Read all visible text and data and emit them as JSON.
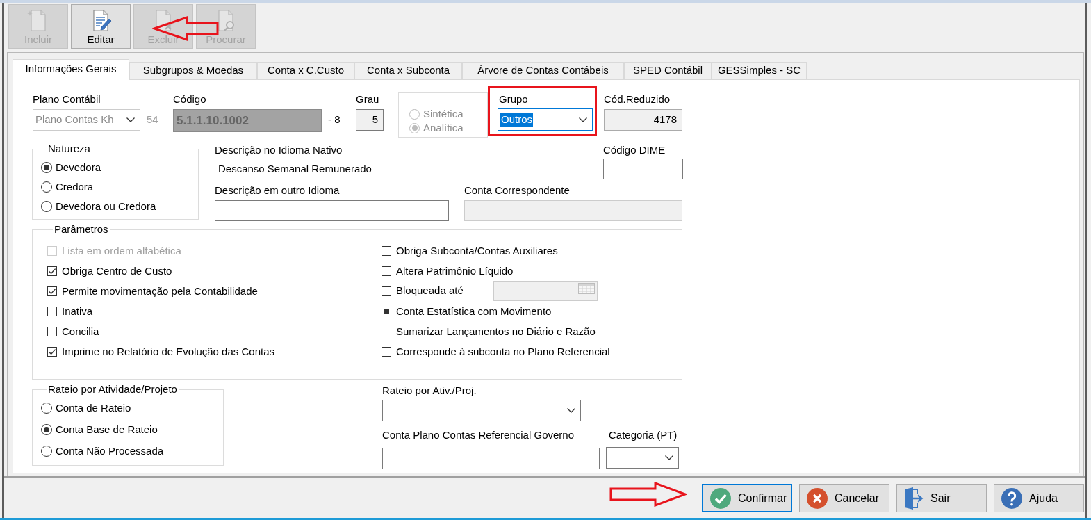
{
  "toolbar": {
    "annotation_arrow": true,
    "buttons": [
      {
        "label": "Incluir",
        "disabled": true
      },
      {
        "label": "Editar",
        "disabled": false
      },
      {
        "label": "Excluir",
        "disabled": true
      },
      {
        "label": "Procurar",
        "disabled": true
      }
    ]
  },
  "tabs": [
    {
      "label": "Informações Gerais",
      "selected": true
    },
    {
      "label": "Subgrupos & Moedas",
      "selected": false
    },
    {
      "label": "Conta x C.Custo",
      "selected": false
    },
    {
      "label": "Conta x Subconta",
      "selected": false
    },
    {
      "label": "Árvore de Contas Contábeis",
      "selected": false
    },
    {
      "label": "SPED Contábil",
      "selected": false
    },
    {
      "label": "GESSimples - SC",
      "selected": false
    }
  ],
  "general": {
    "plano_contabil": {
      "label": "Plano Contábil",
      "value": "Plano Contas Kh",
      "disabled": true,
      "number": "54"
    },
    "codigo": {
      "label": "Código",
      "value": "5.1.1.10.1002",
      "disabled": true,
      "suffix": "- 8"
    },
    "grau": {
      "label": "Grau",
      "value": "5",
      "disabled": true
    },
    "tipo": {
      "disabled": true,
      "options": [
        {
          "label": "Sintética",
          "selected": false
        },
        {
          "label": "Analítica",
          "selected": true
        }
      ]
    },
    "grupo": {
      "label": "Grupo",
      "value": "Outros",
      "focused": true,
      "annotation_box": true
    },
    "cod_reduzido": {
      "label": "Cód.Reduzido",
      "value": "4178",
      "disabled": true
    },
    "natureza": {
      "title": "Natureza",
      "options": [
        {
          "label": "Devedora",
          "selected": true
        },
        {
          "label": "Credora",
          "selected": false
        },
        {
          "label": "Devedora ou Credora",
          "selected": false
        }
      ]
    },
    "descricao_nativo": {
      "label": "Descrição no Idioma Nativo",
      "value": "Descanso Semanal Remunerado"
    },
    "codigo_dime": {
      "label": "Código DIME"
    },
    "descricao_outro": {
      "label": "Descrição em outro Idioma"
    },
    "conta_correspondente": {
      "label": "Conta Correspondente",
      "disabled": true
    },
    "parametros": {
      "title": "Parâmetros",
      "left": [
        {
          "kind": "checkbox",
          "label": "Lista em ordem alfabética",
          "checked": false,
          "disabled": true
        },
        {
          "kind": "checkbox",
          "label": "Obriga Centro de Custo",
          "checked": true,
          "disabled": false
        },
        {
          "kind": "checkbox",
          "label": "Permite movimentação pela Contabilidade",
          "checked": true,
          "disabled": false
        },
        {
          "kind": "checkbox",
          "label": "Inativa",
          "checked": false,
          "disabled": false
        },
        {
          "kind": "checkbox",
          "label": "Concilia",
          "checked": false,
          "disabled": false
        },
        {
          "kind": "checkbox",
          "label": "Imprime no Relatório de Evolução das Contas",
          "checked": true,
          "disabled": false
        }
      ],
      "right": [
        {
          "kind": "checkbox",
          "label": "Obriga Subconta/Contas Auxiliares",
          "checked": false,
          "disabled": false
        },
        {
          "kind": "checkbox",
          "label": "Altera Patrimônio Líquido",
          "checked": false,
          "disabled": false
        },
        {
          "kind": "checkbox",
          "label": "Bloqueada até",
          "checked": false,
          "disabled": false,
          "date_field": {
            "disabled": true
          }
        },
        {
          "kind": "tristate",
          "label": "Conta Estatística com Movimento",
          "checked": true,
          "disabled": false
        },
        {
          "kind": "checkbox",
          "label": "Sumarizar Lançamentos no Diário e Razão",
          "checked": false,
          "disabled": false
        },
        {
          "kind": "checkbox",
          "label": "Corresponde à subconta no Plano Referencial",
          "checked": false,
          "disabled": false
        }
      ]
    },
    "rateio": {
      "title": "Rateio por Atividade/Projeto",
      "options": [
        {
          "label": "Conta de Rateio",
          "selected": false
        },
        {
          "label": "Conta Base de Rateio",
          "selected": true
        },
        {
          "label": "Conta Não Processada",
          "selected": false
        }
      ]
    },
    "rateio_ativ": {
      "label": "Rateio por Ativ./Proj."
    },
    "conta_referencial": {
      "label": "Conta Plano Contas Referencial Governo"
    },
    "categoria": {
      "label": "Categoria (PT)"
    }
  },
  "footer": {
    "annotation_arrow": true,
    "buttons": [
      {
        "label": "Confirmar",
        "focused": true
      },
      {
        "label": "Cancelar",
        "focused": false
      },
      {
        "label": "Sair",
        "focused": false
      },
      {
        "label": "Ajuda",
        "focused": false
      }
    ]
  }
}
